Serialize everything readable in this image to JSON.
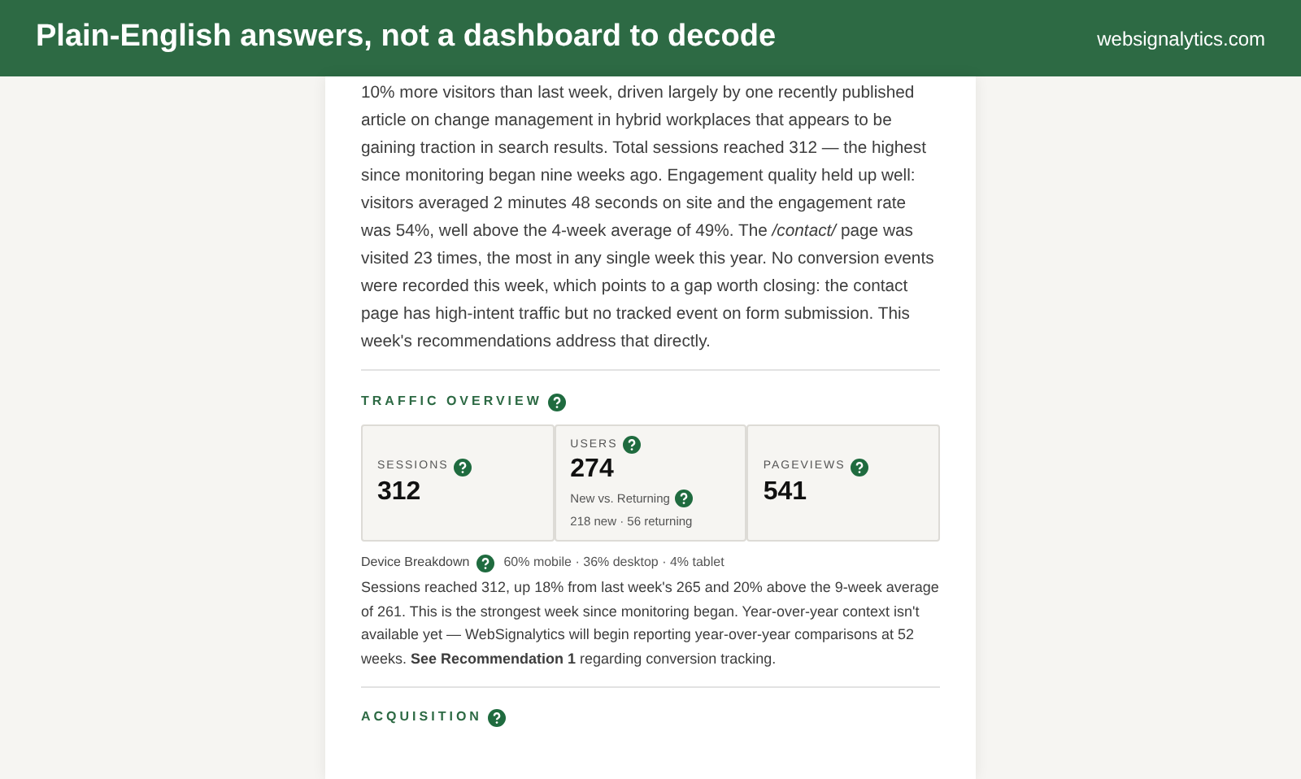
{
  "header": {
    "title": "Plain-English answers, not a dashboard to decode",
    "site": "websignalytics.com"
  },
  "summary": "10% more visitors than last week, driven largely by one recently published article on change management in hybrid workplaces that appears to be gaining traction in search results. Total sessions reached 312 — the highest since monitoring began nine weeks ago. Engagement quality held up well: visitors averaged 2 minutes 48 seconds on site and the engagement rate was 54%, well above the 4-week average of 49%. The */contact/* page was visited 23 times, the most in any single week this year. No conversion events were recorded this week, which points to a gap worth closing: the contact page has high-intent traffic but no tracked event on form submission. This week's recommendations address that directly.",
  "traffic": {
    "heading": "TRAFFIC OVERVIEW",
    "metrics": [
      {
        "label": "SESSIONS",
        "value": "312"
      },
      {
        "label": "USERS",
        "value": "274",
        "sub_label": "New vs. Returning",
        "sub_value": "218 new · 56 returning"
      },
      {
        "label": "PAGEVIEWS",
        "value": "541"
      }
    ],
    "device_label": "Device Breakdown",
    "device_value": "60% mobile · 36% desktop · 4% tablet",
    "note": "Sessions reached 312, up 18% from last week's 265 and 20% above the 9-week average of 261. This is the strongest week since monitoring began. Year-over-year context isn't available yet — WebSignalytics will begin reporting year-over-year comparisons at 52 weeks. **See Recommendation 1** regarding conversion tracking."
  },
  "acquisition": {
    "heading": "ACQUISITION"
  }
}
